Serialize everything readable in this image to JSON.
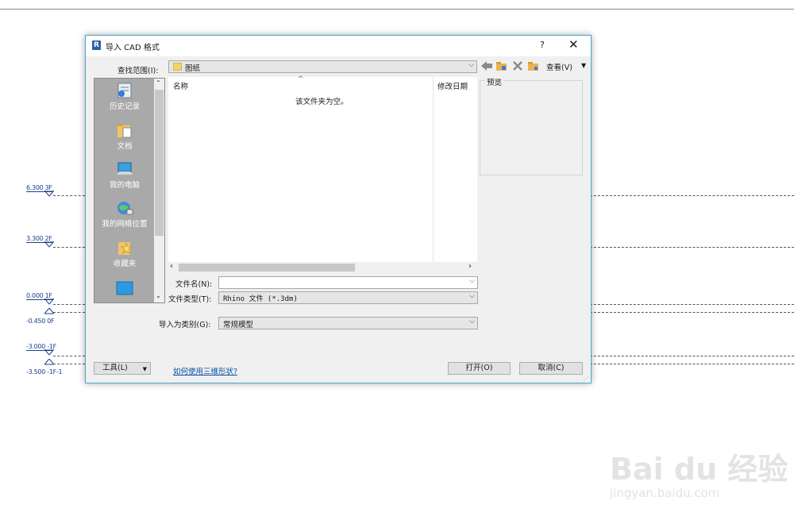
{
  "drawing": {
    "levels": [
      {
        "label": "6.300 3F"
      },
      {
        "label": "3.300 2F"
      },
      {
        "label": "0.000 1F"
      },
      {
        "label": "-0.450 0F"
      },
      {
        "label": "-3.000 -1F"
      },
      {
        "label": "-3.500 -1F-1"
      }
    ]
  },
  "dialog": {
    "title": "导入 CAD 格式",
    "help": "?",
    "close": "✕",
    "look_in_label": "查找范围(I):",
    "look_in_value": "图纸",
    "view_label": "查看(V)",
    "places": [
      {
        "label": "历史记录",
        "icon": "history-icon"
      },
      {
        "label": "文档",
        "icon": "documents-icon"
      },
      {
        "label": "我的电脑",
        "icon": "computer-icon"
      },
      {
        "label": "我的网络位置",
        "icon": "network-icon"
      },
      {
        "label": "收藏夹",
        "icon": "favorites-icon"
      }
    ],
    "columns": {
      "name": "名称",
      "modified": "修改日期"
    },
    "empty_text": "该文件夹为空。",
    "preview_label": "预览",
    "filename_label": "文件名(N):",
    "filename_value": "",
    "filetype_label": "文件类型(T):",
    "filetype_value": "Rhino 文件  (*.3dm)",
    "import_as_label": "导入为类别(G):",
    "import_as_value": "常规模型",
    "tools_label": "工具(L)",
    "help_link": "如何使用三维形状?",
    "open_button": "打开(O)",
    "cancel_button": "取消(C)"
  },
  "watermark": {
    "main": "Bai du 经验",
    "url": "jingyan.baidu.com"
  }
}
